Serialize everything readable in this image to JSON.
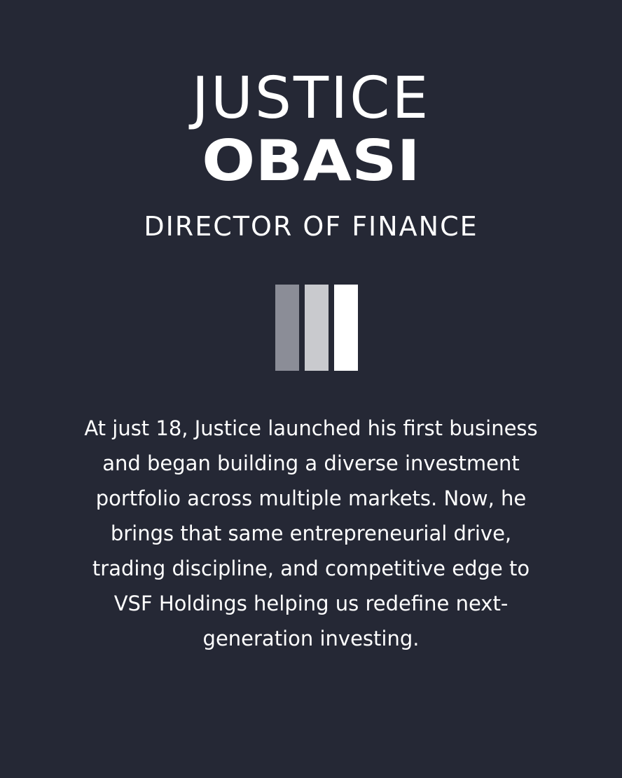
{
  "profile": {
    "first_name": "JUSTICE",
    "last_name": "OBASI",
    "job_title": "DIRECTOR OF FINANCE",
    "bio": "At just 18, Justice launched his first business and began building a diverse investment portfolio across multiple markets. Now, he brings that same entrepreneurial drive, trading discipline, and competitive edge to VSF Holdings  helping us redefine next-generation investing."
  },
  "logo": {
    "icon": "three-vertical-bars-logo",
    "bar_colors": [
      "#8b8d97",
      "#c9cace",
      "#ffffff"
    ]
  },
  "colors": {
    "background": "#252835",
    "text": "#ffffff"
  }
}
